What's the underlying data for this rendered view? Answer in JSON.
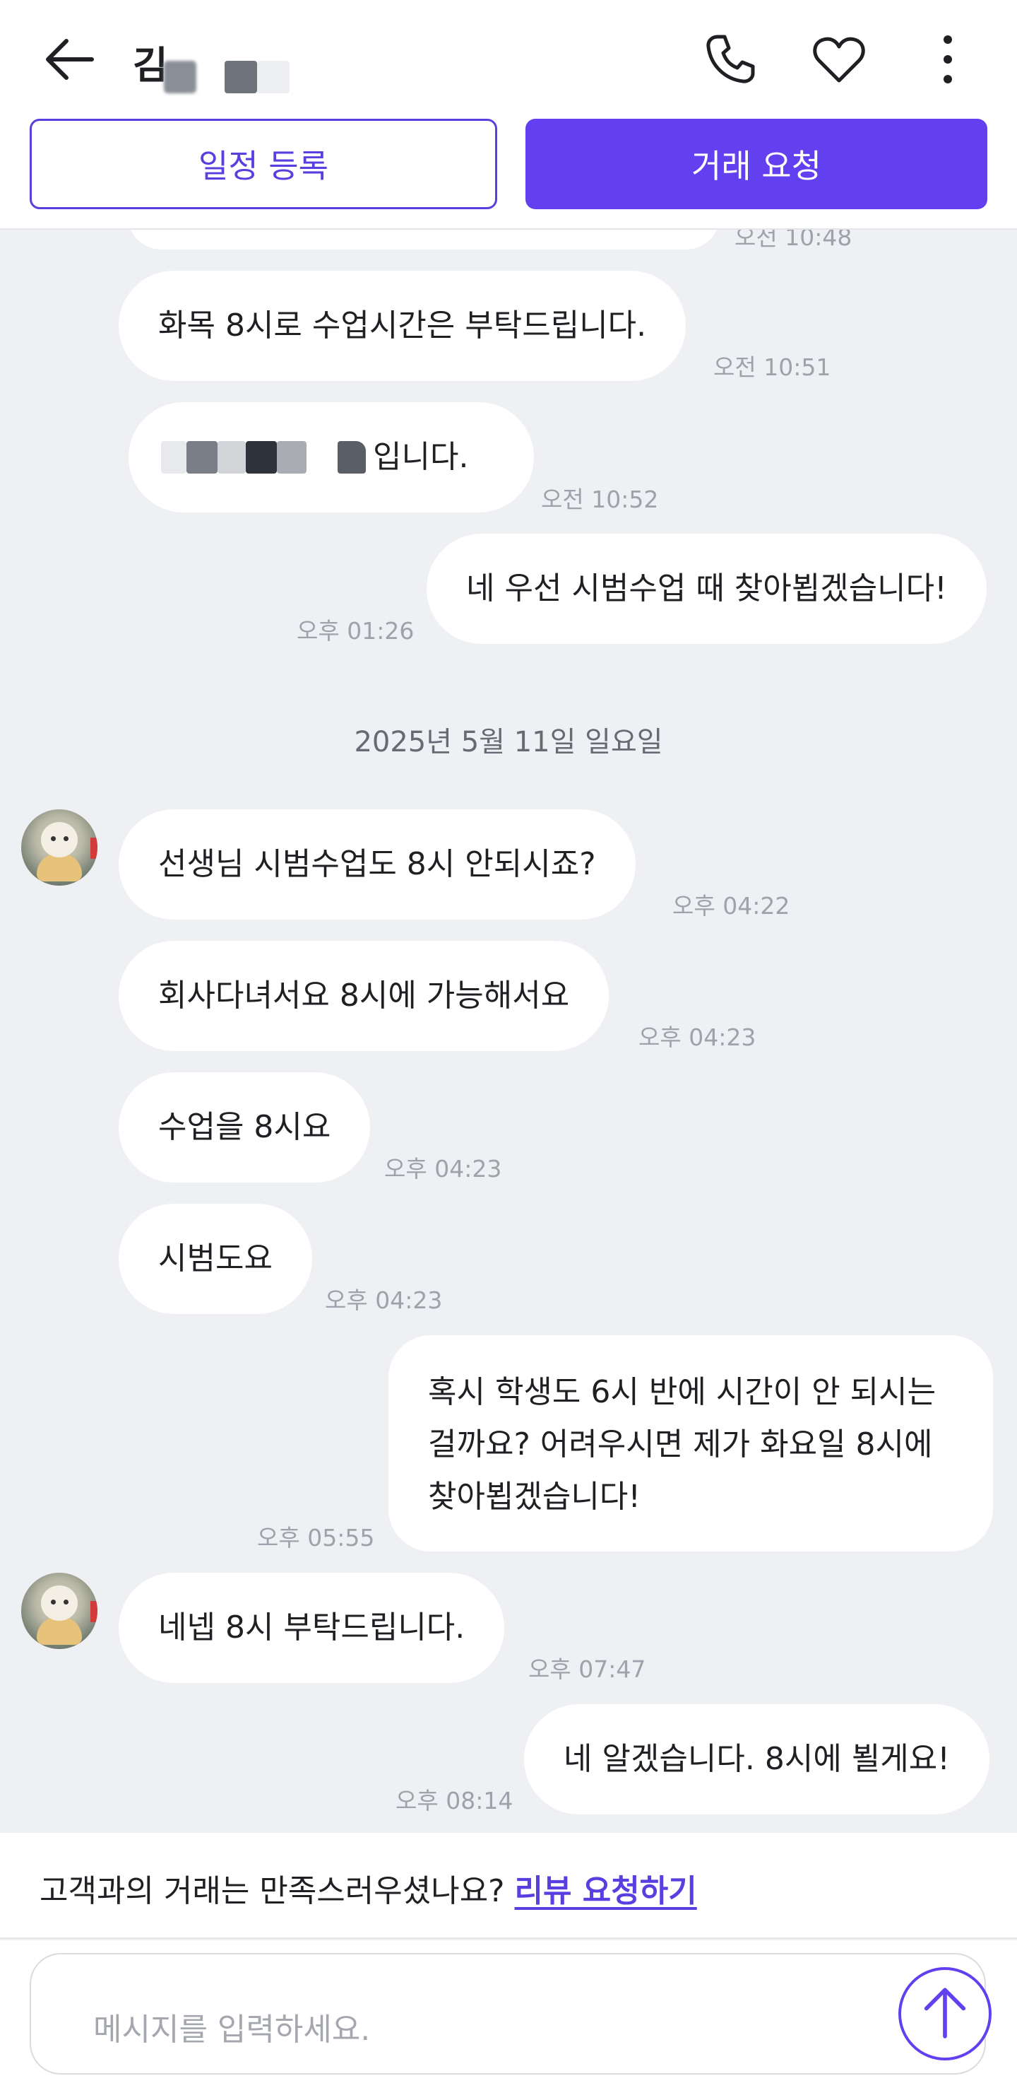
{
  "header": {
    "title": "김",
    "back_icon": "arrow-left-icon",
    "call_icon": "phone-icon",
    "favorite_icon": "heart-icon",
    "more_icon": "more-vertical-icon",
    "schedule_button": "일정 등록",
    "deal_button": "거래 요청"
  },
  "messages": [
    {
      "time": "오전 10:48"
    },
    {
      "text": "화목 8시로  수업시간은 부탁드립니다.",
      "time": "오전 10:51"
    },
    {
      "text": "입니다.",
      "time": "오전 10:52"
    },
    {
      "text": "네 우선 시범수업 때 찾아뵙겠습니다!",
      "time": "오후 01:26"
    },
    {
      "date": "2025년 5월 11일 일요일"
    },
    {
      "text": "선생님  시범수업도  8시 안되시죠?",
      "time": "오후 04:22"
    },
    {
      "text": "회사다녀서요  8시에 가능해서요",
      "time": "오후 04:23"
    },
    {
      "text": "수업을 8시요",
      "time": "오후 04:23"
    },
    {
      "text": "시범도요",
      "time": "오후 04:23"
    },
    {
      "lines": [
        "혹시 학생도 6시 반에 시간이 안 되시는",
        "걸까요? 어려우시면 제가 화요일 8시에",
        "찾아뵙겠습니다!"
      ],
      "time": "오후 05:55"
    },
    {
      "text": "네넵  8시 부탁드립니다.",
      "time": "오후 07:47"
    },
    {
      "text": "네 알겠습니다. 8시에 뵐게요!",
      "time": "오후 08:14"
    }
  ],
  "review": {
    "question": "고객과의 거래는 만족스러우셨나요?",
    "link": "리뷰 요청하기"
  },
  "composer": {
    "placeholder": "메시지를 입력하세요.",
    "send_icon": "arrow-up-icon"
  },
  "colors": {
    "accent": "#6240f0",
    "chat_background": "#eef0f3",
    "bubble": "#ffffff",
    "time_text": "#9ea2aa"
  }
}
